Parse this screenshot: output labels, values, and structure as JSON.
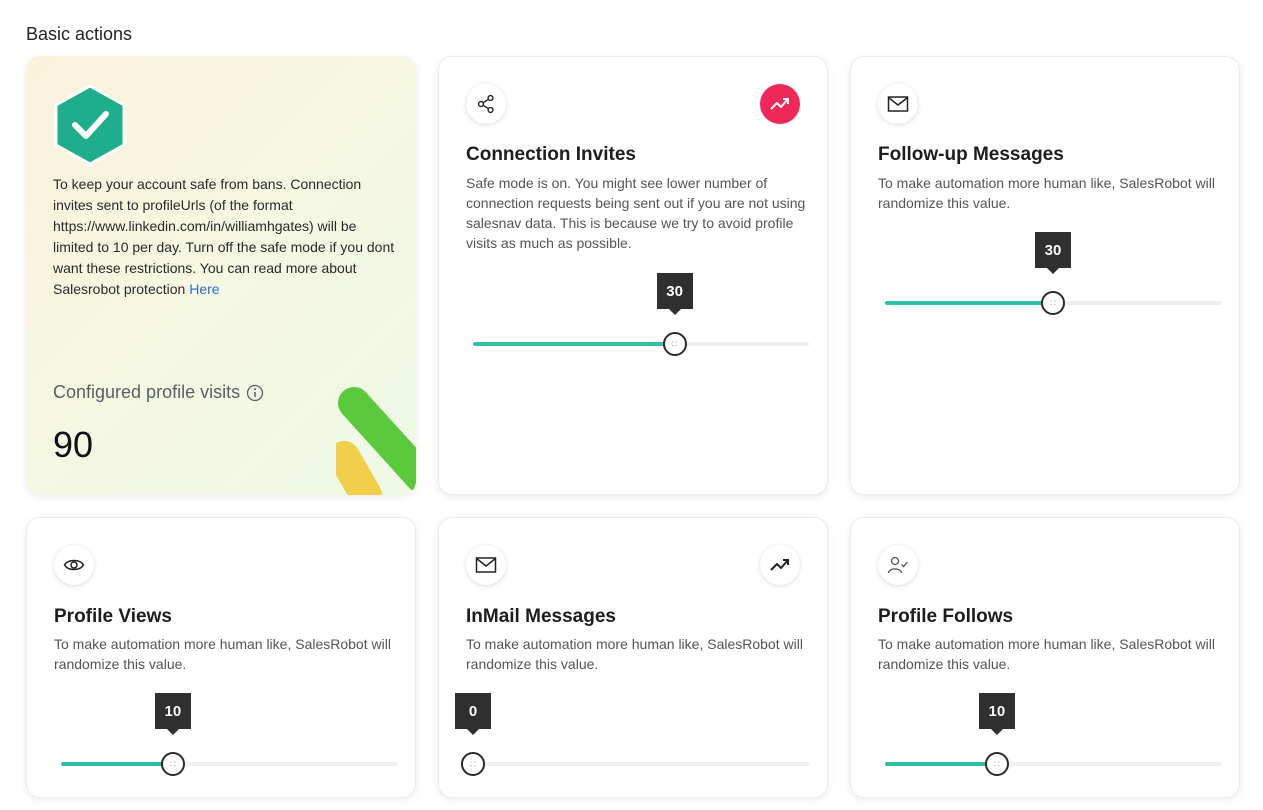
{
  "section_title": "Basic actions",
  "safe_card": {
    "text": "To keep your account safe from bans. Connection invites sent to profileUrls (of the format https://www.linkedin.com/in/williamhgates) will be limited to 10 per day. Turn off the safe mode if you dont want these restrictions. You can read more about Salesrobot protection",
    "link_label": "Here",
    "visits_label": "Configured profile visits",
    "visits_value": "90",
    "colors": {
      "hex": "#1fae8c",
      "deco_green": "#5ac93c",
      "deco_yellow": "#f2cf4a"
    }
  },
  "cards": {
    "connection_invites": {
      "title": "Connection Invites",
      "description": "Safe mode is on. You might see lower number of connection requests being sent out if you are not using salesnav data. This is because we try to avoid profile visits as much as possible.",
      "value": "30",
      "fraction": 0.6,
      "icon": "share-icon",
      "trend_active": true
    },
    "followup_messages": {
      "title": "Follow-up Messages",
      "description": "To make automation more human like, SalesRobot will randomize this value.",
      "value": "30",
      "fraction": 0.5,
      "icon": "mail-icon"
    },
    "profile_views": {
      "title": "Profile Views",
      "description": "To make automation more human like, SalesRobot will randomize this value.",
      "value": "10",
      "fraction": 0.333,
      "icon": "eye-icon"
    },
    "inmail_messages": {
      "title": "InMail Messages",
      "description": "To make automation more human like, SalesRobot will randomize this value.",
      "value": "0",
      "fraction": 0.0,
      "icon": "mail-icon",
      "trend_active": false
    },
    "profile_follows": {
      "title": "Profile Follows",
      "description": "To make automation more human like, SalesRobot will randomize this value.",
      "value": "10",
      "fraction": 0.333,
      "icon": "user-check-icon"
    }
  },
  "colors": {
    "slider_fill": "#2fc1a5",
    "slider_track": "#eeeeee",
    "trend_active": "#f0285a",
    "tooltip": "#2f2f2f"
  }
}
